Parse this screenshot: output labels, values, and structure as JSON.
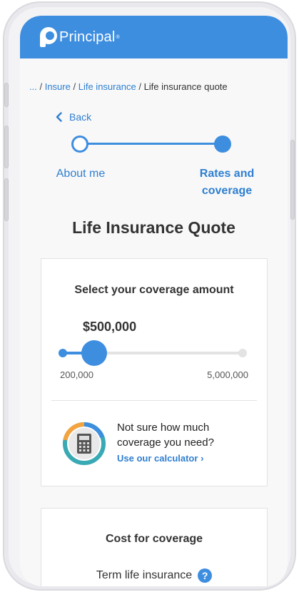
{
  "header": {
    "brand": "Principal",
    "brand_reg": "®"
  },
  "breadcrumb": {
    "ellipsis": "...",
    "items": [
      "Insure",
      "Life insurance"
    ],
    "current": "Life insurance quote",
    "separator": "/"
  },
  "back": {
    "label": "Back"
  },
  "stepper": {
    "steps": [
      {
        "label": "About me",
        "state": "complete"
      },
      {
        "label": "Rates and coverage",
        "state": "current"
      }
    ]
  },
  "page": {
    "title": "Life Insurance Quote"
  },
  "coverage": {
    "heading": "Select your coverage amount",
    "amount": "$500,000",
    "min_label": "200,000",
    "max_label": "5,000,000",
    "slider_value": 500000,
    "slider_min": 200000,
    "slider_max": 5000000
  },
  "calculator": {
    "prompt": "Not sure how much coverage you need?",
    "link": "Use our calculator",
    "link_chevron": "›"
  },
  "cost": {
    "heading": "Cost for coverage",
    "term_label": "Term life insurance",
    "help": "?"
  },
  "colors": {
    "brand_blue": "#3e8ee0",
    "link_blue": "#2f7fd1",
    "calc_ring_orange": "#f5a33d",
    "calc_ring_teal": "#39a9b4"
  }
}
